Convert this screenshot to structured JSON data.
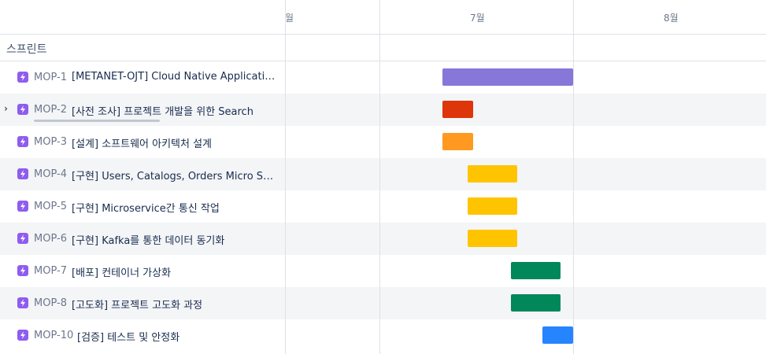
{
  "timeline": {
    "months": [
      {
        "label": "월"
      },
      {
        "label": "7월"
      },
      {
        "label": "8월"
      }
    ],
    "sprint_label": "스프린트"
  },
  "issues": [
    {
      "key": "MOP-1",
      "title": "[METANET-OJT] Cloud Native Application...",
      "color": "#8777d9"
    },
    {
      "key": "MOP-2",
      "title": "[사전 조사] 프로젝트 개발을 위한 Search",
      "color": "#de350b",
      "expandable": true
    },
    {
      "key": "MOP-3",
      "title": "[설계] 소프트웨어 아키텍처 설계",
      "color": "#ff991f"
    },
    {
      "key": "MOP-4",
      "title": "[구현] Users, Catalogs, Orders Micro Servi...",
      "color": "#ffc400"
    },
    {
      "key": "MOP-5",
      "title": "[구현] Microservice간 통신 작업",
      "color": "#ffc400"
    },
    {
      "key": "MOP-6",
      "title": "[구현] Kafka를 통한 데이터 동기화",
      "color": "#ffc400"
    },
    {
      "key": "MOP-7",
      "title": "[배포] 컨테이너 가상화",
      "color": "#00875a"
    },
    {
      "key": "MOP-8",
      "title": "[고도화] 프로젝트 고도화 과정",
      "color": "#00875a"
    },
    {
      "key": "MOP-10",
      "title": "[검증] 테스트 및 안정화",
      "color": "#2684ff"
    }
  ],
  "icons": {
    "epic": "epic-lightning-icon",
    "expand": "chevron-right-icon"
  }
}
